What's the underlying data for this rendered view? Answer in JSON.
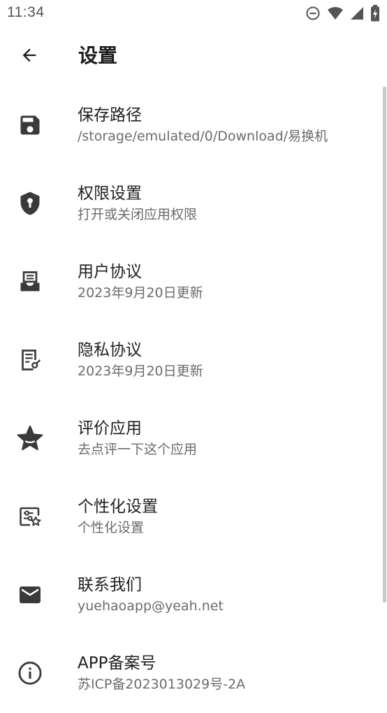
{
  "status_bar": {
    "time": "11:34",
    "icons": [
      "do-not-disturb-icon",
      "wifi-icon",
      "cell-signal-icon",
      "battery-charging-icon"
    ]
  },
  "app_bar": {
    "back_icon": "arrow-back-icon",
    "title": "设置"
  },
  "settings": [
    {
      "icon": "save-icon",
      "title": "保存路径",
      "subtitle": "/storage/emulated/0/Download/易换机"
    },
    {
      "icon": "shield-key-icon",
      "title": "权限设置",
      "subtitle": "打开或关闭应用权限"
    },
    {
      "icon": "inbox-document-icon",
      "title": "用户协议",
      "subtitle": "2023年9月20日更新"
    },
    {
      "icon": "document-key-icon",
      "title": "隐私协议",
      "subtitle": "2023年9月20日更新"
    },
    {
      "icon": "star-icon",
      "title": "评价应用",
      "subtitle": "去点评一下这个应用"
    },
    {
      "icon": "personalize-icon",
      "title": "个性化设置",
      "subtitle": "个性化设置"
    },
    {
      "icon": "mail-icon",
      "title": "联系我们",
      "subtitle": "yuehaoapp@yeah.net"
    },
    {
      "icon": "info-icon",
      "title": "APP备案号",
      "subtitle": "苏ICP备2023013029号-2A"
    }
  ],
  "colors": {
    "icon": "#3a3a3a",
    "title": "#1f1f1f",
    "subtitle": "#6b6b6b",
    "status": "#555555"
  }
}
